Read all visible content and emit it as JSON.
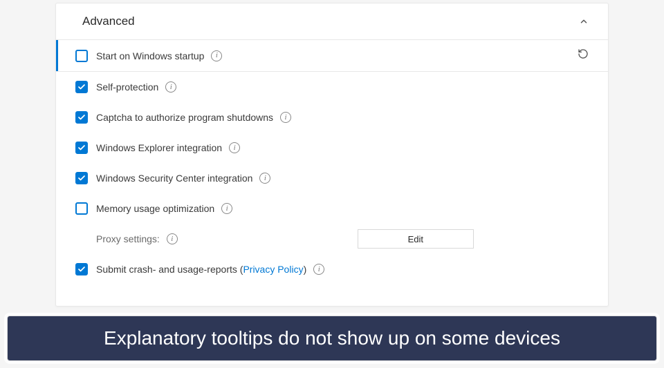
{
  "section": {
    "title": "Advanced"
  },
  "options": [
    {
      "label": "Start on Windows startup",
      "checked": false,
      "hasInfo": true,
      "highlighted": true,
      "hasReset": true
    },
    {
      "label": "Self-protection",
      "checked": true,
      "hasInfo": true
    },
    {
      "label": "Captcha to authorize program shutdowns",
      "checked": true,
      "hasInfo": true
    },
    {
      "label": "Windows Explorer integration",
      "checked": true,
      "hasInfo": true
    },
    {
      "label": "Windows Security Center integration",
      "checked": true,
      "hasInfo": true
    },
    {
      "label": "Memory usage optimization",
      "checked": false,
      "hasInfo": true
    }
  ],
  "proxy": {
    "label": "Proxy settings:",
    "button": "Edit"
  },
  "submit": {
    "prefix": "Submit crash- and usage-reports (",
    "link": "Privacy Policy",
    "suffix": ")",
    "checked": true
  },
  "caption": "Explanatory tooltips do not show up on some devices"
}
